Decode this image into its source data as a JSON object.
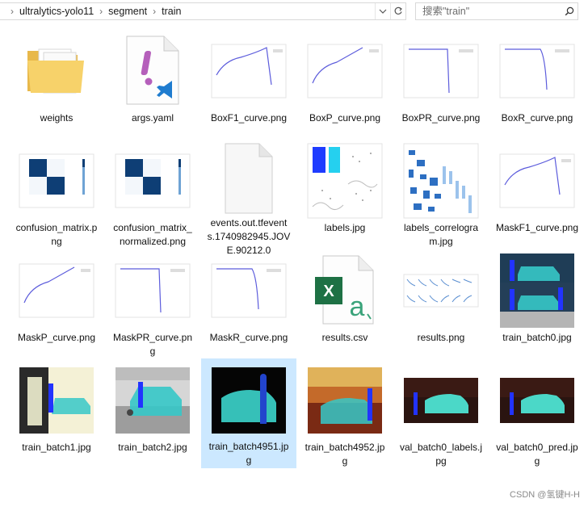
{
  "breadcrumb": {
    "items": [
      "ultralytics-yolo11",
      "segment",
      "train"
    ]
  },
  "search": {
    "placeholder": "搜索\"train\""
  },
  "files": [
    {
      "name": "weights",
      "kind": "folder"
    },
    {
      "name": "args.yaml",
      "kind": "yaml"
    },
    {
      "name": "BoxF1_curve.png",
      "kind": "f1curve"
    },
    {
      "name": "BoxP_curve.png",
      "kind": "pcurve"
    },
    {
      "name": "BoxPR_curve.png",
      "kind": "prcurve"
    },
    {
      "name": "BoxR_curve.png",
      "kind": "rcurve"
    },
    {
      "name": "confusion_matrix.png",
      "kind": "confusion"
    },
    {
      "name": "confusion_matrix_normalized.png",
      "kind": "confusion"
    },
    {
      "name": "events.out.tfevents.1740982945.JOVE.90212.0",
      "kind": "blank"
    },
    {
      "name": "labels.jpg",
      "kind": "labels"
    },
    {
      "name": "labels_correlogram.jpg",
      "kind": "correlogram"
    },
    {
      "name": "MaskF1_curve.png",
      "kind": "f1curve"
    },
    {
      "name": "MaskP_curve.png",
      "kind": "pcurve"
    },
    {
      "name": "MaskPR_curve.png",
      "kind": "prcurve"
    },
    {
      "name": "MaskR_curve.png",
      "kind": "rcurve"
    },
    {
      "name": "results.csv",
      "kind": "csv"
    },
    {
      "name": "results.png",
      "kind": "results"
    },
    {
      "name": "train_batch0.jpg",
      "kind": "batch0"
    },
    {
      "name": "train_batch1.jpg",
      "kind": "batch1"
    },
    {
      "name": "train_batch2.jpg",
      "kind": "batch2"
    },
    {
      "name": "train_batch4951.jpg",
      "kind": "batch4951",
      "selected": true
    },
    {
      "name": "train_batch4952.jpg",
      "kind": "batch4952"
    },
    {
      "name": "val_batch0_labels.jpg",
      "kind": "valbatch"
    },
    {
      "name": "val_batch0_pred.jpg",
      "kind": "valbatch"
    }
  ],
  "watermark": "CSDN @氢键H-H",
  "icons": {
    "chevron": "chevron-right-icon",
    "address_dropdown": "chevron-down-icon",
    "refresh": "refresh-icon",
    "search": "search-icon"
  }
}
